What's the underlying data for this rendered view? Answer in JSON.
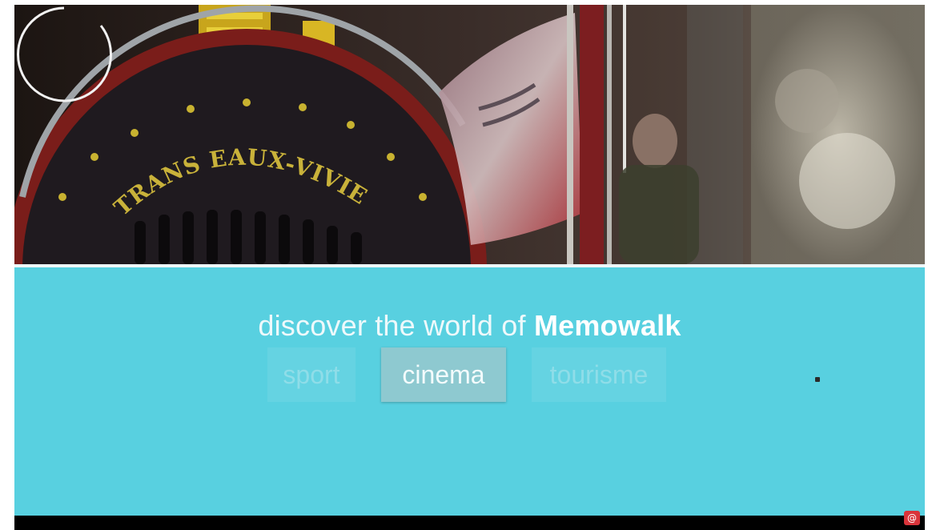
{
  "hero": {
    "badge_text": "TRANS EAUX-VIVIENS",
    "spinner_icon": "loading-spinner-icon"
  },
  "panel": {
    "headline_prefix": "discover the world of ",
    "headline_brand": "Memowalk",
    "background_color": "#58d0e0"
  },
  "tabs": [
    {
      "label": "sport",
      "selected": false
    },
    {
      "label": "cinema",
      "selected": true
    },
    {
      "label": "tourisme",
      "selected": false
    }
  ],
  "corner_badge": {
    "icon": "app-badge-icon",
    "text": "@"
  }
}
